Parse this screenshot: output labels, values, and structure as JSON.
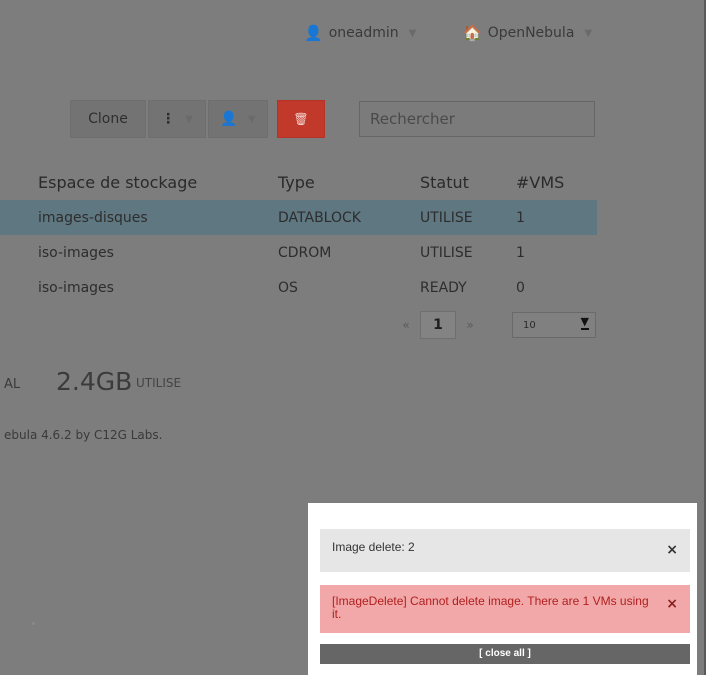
{
  "header": {
    "user": {
      "name": "oneadmin",
      "icon": "user-icon"
    },
    "zone": {
      "name": "OpenNebula",
      "icon": "home-icon"
    }
  },
  "toolbar": {
    "clone_label": "Clone",
    "more_icon": "⋮",
    "user_icon": "👤",
    "delete_icon": "🗑",
    "search_placeholder": "Rechercher"
  },
  "table": {
    "columns": [
      "Espace de stockage",
      "Type",
      "Statut",
      "#VMS"
    ],
    "rows": [
      {
        "datastore": "images-disques",
        "type": "DATABLOCK",
        "status": "UTILISE",
        "vms": "1",
        "selected": true
      },
      {
        "datastore": "iso-images",
        "type": "CDROM",
        "status": "UTILISE",
        "vms": "1",
        "selected": false
      },
      {
        "datastore": "iso-images",
        "type": "OS",
        "status": "READY",
        "vms": "0",
        "selected": false
      }
    ]
  },
  "pagination": {
    "prev": "«",
    "current": "1",
    "next": "»",
    "page_size": "10"
  },
  "footer": {
    "total_prefix": "AL",
    "total_size": "2.4GB",
    "total_label": "UTILISE",
    "credits": "ebula 4.6.2 by C12G Labs."
  },
  "notifications": {
    "info": "Image delete: 2",
    "error": "[ImageDelete] Cannot delete image. There are 1 VMs using it.",
    "close_icon": "×",
    "close_all": "[ close all ]"
  },
  "colors": {
    "overlay": "#7d7d7d",
    "selected_row": "#5f7781",
    "delete_button": "#c0392b",
    "error_bg": "#f2a8a8",
    "error_text": "#b02020"
  }
}
